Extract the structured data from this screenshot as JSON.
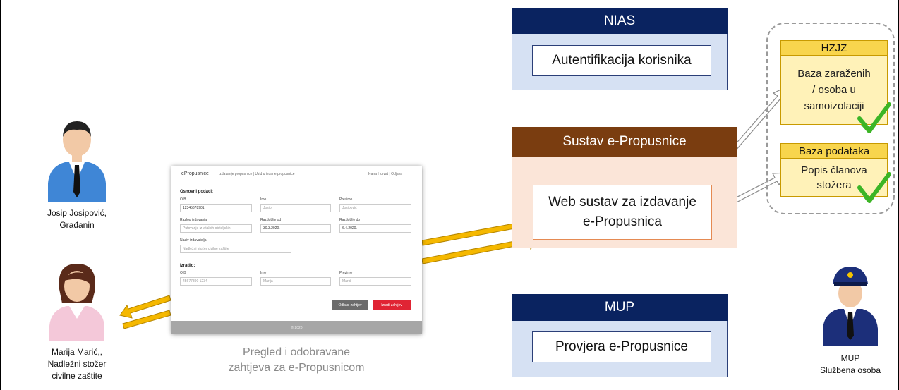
{
  "screenshot": {
    "brand": "ePropusnice",
    "nav_links": "Izdavanje propusnice  |  Uvid u izdane propusnice",
    "user": "Ivana Horvat  |  Odjava",
    "section_basic": "Osnovni podaci:",
    "lbl_oib": "OIB",
    "lbl_ime": "Ime",
    "lbl_prezime": "Prezime",
    "val_oib": "12345678901",
    "val_ime": "Josip",
    "val_prezime": "Josipović",
    "lbl_razlog": "Razlog izdavanja",
    "lbl_od": "Razdoblje od",
    "lbl_do": "Razdoblje do",
    "val_razlog": "Putovanje iz vitalnih obiteljskih",
    "val_od": "30.3.2020.",
    "val_do": "6.4.2020.",
    "lbl_naziv": "Naziv izdavatelja",
    "val_naziv": "Nadležni stožer civilne zaštite",
    "section_izradio": "Izradio:",
    "lbl_oib2": "OIB",
    "lbl_ime2": "Ime",
    "lbl_prezime2": "Prezime",
    "val_oib2": "45677890 1234",
    "val_ime2": "Marija",
    "val_prezime2": "Marić",
    "btn_reject": "Odbaci zahtjev",
    "btn_create": "Izradi zahtjev",
    "footer": "© 2020"
  },
  "caption": {
    "line1": "Pregled i odobravane",
    "line2": "zahtjeva za e-Propusnicom"
  },
  "people": {
    "citizen": {
      "line1": "Josip Josipović,",
      "line2": "Građanin"
    },
    "staff": {
      "line1": "Marija Marić,,",
      "line2": "Nadležni stožer",
      "line3": "civilne zaštite"
    },
    "police": {
      "line1": "MUP",
      "line2": "Službena osoba"
    }
  },
  "nias": {
    "title": "NIAS",
    "box": "Autentifikacija korisnika"
  },
  "sustav": {
    "title": "Sustav e-Propusnice",
    "box_line1": "Web sustav za izdavanje",
    "box_line2": "e-Propusnica"
  },
  "mup": {
    "title": "MUP",
    "box": "Provjera e-Propusnice"
  },
  "hzjz": {
    "title": "HZJZ",
    "line1": "Baza zaraženih",
    "line2": "/ osoba u",
    "line3": "samoizolaciji"
  },
  "baza": {
    "title": "Baza podataka",
    "line1": "Popis članova",
    "line2": "stožera"
  },
  "colors": {
    "navy": "#0a2360",
    "brown": "#7a3d10",
    "arrow_yellow": "#f5b800",
    "check_green": "#3cb526"
  }
}
